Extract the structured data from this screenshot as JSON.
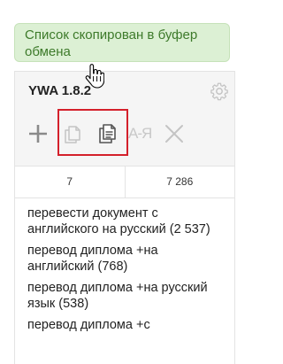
{
  "toast": {
    "message": "Список скопирован в буфер обмена",
    "bg_color": "#dcf0d4",
    "text_color": "#3d7a2a"
  },
  "app": {
    "title": "YWA 1.8.2"
  },
  "toolbar": {
    "icons": [
      "plus-icon",
      "copy-icon",
      "copy-list-icon",
      "case-icon",
      "close-icon"
    ],
    "case_label": "A-Я"
  },
  "counts": {
    "left": "7",
    "right": "7 286"
  },
  "keywords": [
    "перевести документ с английского на русский (2 537)",
    "перевод диплома +на английский (768)",
    "перевод диплома +на русский язык (538)",
    "перевод диплома +с"
  ],
  "highlight_color": "#d4202b"
}
